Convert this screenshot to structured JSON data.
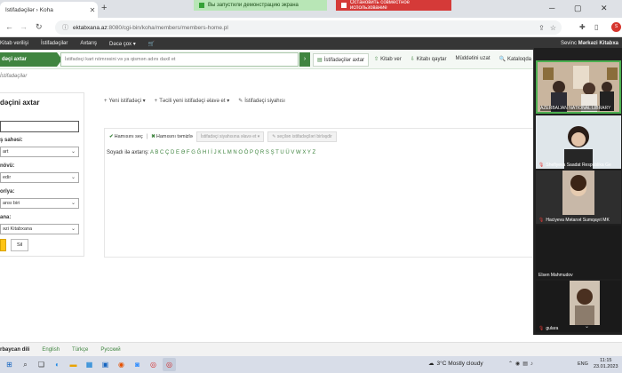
{
  "browser": {
    "tab_title": "İstifadəçilər › Koha",
    "new_tab": "+",
    "notice_demo": "Вы запустили демонстрацию экрана",
    "notice_stop": "Остановить совместное использование",
    "url_host": "ektabxana.az",
    "url_path": ":8080/cgi-bin/koha/members/members-home.pl",
    "profile_initial": "S"
  },
  "koha": {
    "nav": [
      "Kitab verilişi",
      "İstifadəçilər",
      "Axtarış",
      "Dəcə çox ▾"
    ],
    "user_prefix": "Sevinc",
    "user_branch": "Mərkəzi Kitabxa",
    "search_tab": "dəçi axtar",
    "search_placeholder": "İstifadəçi kart nömrəsini və ya qismən adını daxil et",
    "quick_links": [
      "İstifadəçilər axtar",
      "Kitab ver",
      "Kitabı qaytar",
      "Müddətini uzat",
      "Kataloqda"
    ],
    "breadcrumb": "İstifadəçilər"
  },
  "left_panel": {
    "title": "dəçini axtar",
    "labels": [
      "ş sahəsi:",
      "növü:",
      "orîya:",
      "ana:"
    ],
    "selects": [
      "art",
      "edir",
      "ansı biri",
      "əzi Kitabxana"
    ],
    "clear_btn": "Sil"
  },
  "main": {
    "toolbar": [
      "Yeni istifadəçi ▾",
      "Təcili yeni istifadəçi əlavə et ▾",
      "İstifadəçi siyahısı"
    ],
    "select_all": "Hamısını seç",
    "clear_all": "Hamısını təmizlə",
    "add_to_list": "İstifadəçi siyahısına əlavə et ▾",
    "merge": "seçilən istifadəçiləri birləşdir",
    "alpha_label": "Soyadı ilə axtarış:",
    "alpha_letters": "A B C Ç D E Ə F G Ğ H I İ J K L M N O Ö P Q R S Ş T U Ü V W X Y Z"
  },
  "footer": {
    "current_lang": "rbaycan dili",
    "langs": [
      "English",
      "Türkçe",
      "Русский"
    ]
  },
  "video": {
    "participants": [
      "AZERBAIJAN NATIONAL LIBRARY",
      "Shefiyeva Saadat Respublika Ge",
      "Haciyeva Mətanət Sumqayıt MK",
      "Elsen Mahmudov",
      "gulara"
    ]
  },
  "taskbar": {
    "weather": "3°C  Mostly cloudy",
    "lang": "ENG",
    "time": "11:15",
    "date": "23.01.2023"
  }
}
